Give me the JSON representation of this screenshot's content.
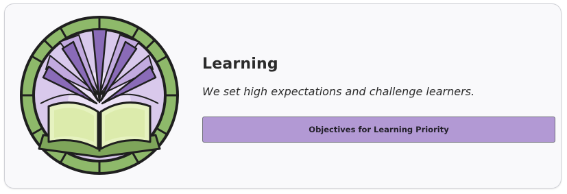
{
  "priority_card": {
    "title": "Learning",
    "tagline": "We set high expectations and challenge learners.",
    "button_label": "Objectives for Learning Priority",
    "emblem_icon": "open-book-stained-glass-icon",
    "colors": {
      "button_bg": "#b299d4",
      "emblem_green": "#8eb96a",
      "emblem_purple": "#a98ccf",
      "emblem_lavender": "#d9c9ec",
      "book_pages": "#e6f2c0"
    }
  }
}
